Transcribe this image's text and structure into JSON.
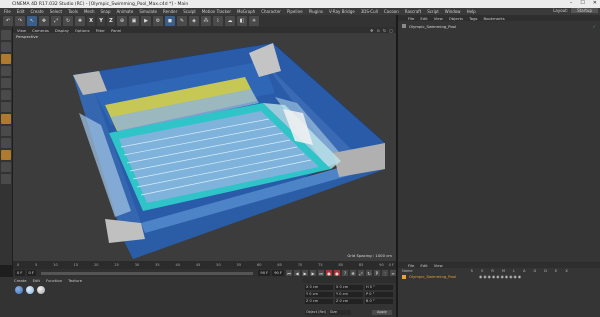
{
  "window": {
    "title": "CINEMA 4D R17.032 Studio (RC) - [Olympic_Swimming_Pool_Max.c4d *] - Main",
    "controls": [
      "–",
      "☐",
      "✕"
    ]
  },
  "menubar": {
    "items": [
      "File",
      "Edit",
      "Create",
      "Select",
      "Tools",
      "Mesh",
      "Snap",
      "Animate",
      "Simulate",
      "Render",
      "Sculpt",
      "Motion Tracker",
      "MoGraph",
      "Character",
      "Pipeline",
      "Plugins",
      "V-Ray Bridge",
      "3DS-Cull",
      "Cacoon",
      "Rascraft",
      "Script",
      "Window",
      "Help"
    ],
    "layout_label": "Layout:",
    "layout_value": "Startup"
  },
  "toolbar": {
    "axis_x": "X",
    "axis_y": "Y",
    "axis_z": "Z"
  },
  "viewport": {
    "menu": [
      "View",
      "Cameras",
      "Display",
      "Options",
      "Filter",
      "Panel"
    ],
    "label": "Perspective",
    "grid_spacing": "Grid Spacing : 1000 cm"
  },
  "timeline": {
    "ticks": [
      "0",
      "5",
      "10",
      "15",
      "20",
      "25",
      "30",
      "35",
      "40",
      "45",
      "50",
      "55",
      "60",
      "65",
      "70",
      "75",
      "80",
      "85",
      "90"
    ],
    "end_label": "0 F"
  },
  "transport": {
    "start_frame": "0 F",
    "current_frame": "0 F",
    "end_frame": "90 F",
    "max_frame": "90 F"
  },
  "materials": {
    "menu": [
      "Create",
      "Edit",
      "Function",
      "Texture"
    ],
    "swatches": [
      "#3d6fb0",
      "#8ab0d8",
      "#c8c8c8"
    ]
  },
  "coordinates": {
    "rows": [
      [
        "X  0 cm",
        "X  0 cm",
        "H  0 °"
      ],
      [
        "Y  0 cm",
        "Y  0 cm",
        "P  0 °"
      ],
      [
        "Z  0 cm",
        "Z  0 cm",
        "B  0 °"
      ]
    ],
    "mode": [
      "Object (Rel)",
      "Size"
    ],
    "apply": "Apply"
  },
  "objects": {
    "menu": [
      "File",
      "Edit",
      "View",
      "Objects",
      "Tags",
      "Bookmarks"
    ],
    "items": [
      {
        "name": "Olympic_Swimming_Pool"
      }
    ]
  },
  "attributes": {
    "menu": [
      "File",
      "Edit",
      "View"
    ],
    "headers": [
      "Name",
      "S",
      "V",
      "R",
      "M",
      "L",
      "A",
      "G",
      "D",
      "E",
      "X"
    ],
    "items": [
      {
        "name": "Olympic_Swimming_Pool"
      }
    ]
  },
  "colors": {
    "pool_water": "#7fb3dc",
    "lane_rope": "#2ec4c8",
    "seats_yellow": "#d8d24a",
    "stadium_blue": "#2f5da8",
    "wall_gray": "#b8b8b8",
    "accent_orange": "#e8a33a"
  }
}
